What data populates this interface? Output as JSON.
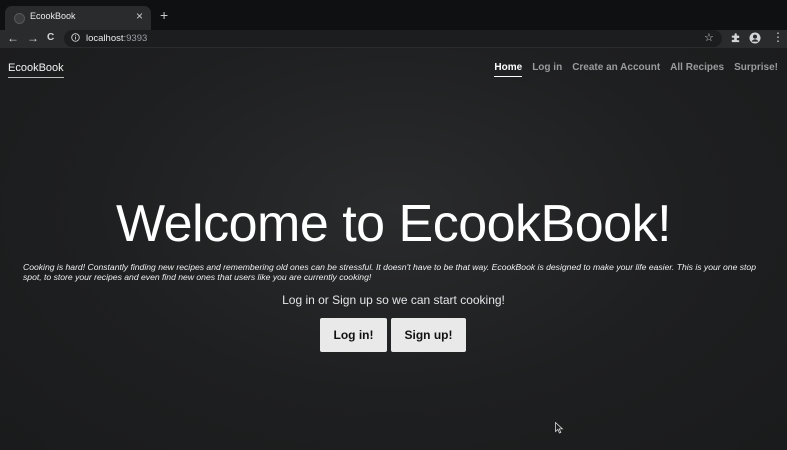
{
  "browser": {
    "tab_title": "EcookBook",
    "close_glyph": "×",
    "new_tab_glyph": "+",
    "back_glyph": "←",
    "forward_glyph": "→",
    "reload_glyph": "C",
    "url_host": "localhost",
    "url_port": ":9393",
    "star_glyph": "☆",
    "menu_glyph": "⋮",
    "icons": [
      "tab-favicon",
      "info-icon",
      "star-icon",
      "extensions-icon",
      "profile-icon",
      "menu-icon"
    ]
  },
  "navbar": {
    "brand": "EcookBook",
    "links": [
      {
        "label": "Home",
        "active": true
      },
      {
        "label": "Log in",
        "active": false
      },
      {
        "label": "Create an Account",
        "active": false
      },
      {
        "label": "All Recipes",
        "active": false
      },
      {
        "label": "Surprise!",
        "active": false
      }
    ]
  },
  "hero": {
    "title": "Welcome to EcookBook!",
    "description": "Cooking is hard! Constantly finding new recipes and remembering old ones can be stressful. It doesn't have to be that way. EcookBook is designed to make your life easier. This is your one stop spot, to store your recipes and even find new ones that users like you are currently cooking!",
    "cta": "Log in or Sign up so we can start cooking!",
    "login_button": "Log in!",
    "signup_button": "Sign up!"
  },
  "colors": {
    "page_bg": "#1f2021",
    "text": "#ffffff",
    "nav_inactive": "#9a9b9d",
    "button_bg": "#e9e9e9"
  }
}
